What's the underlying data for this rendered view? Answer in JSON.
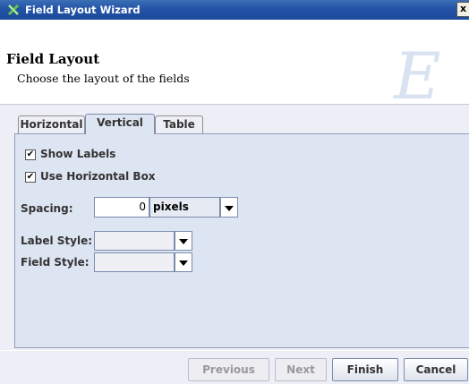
{
  "window": {
    "title": "Field Layout Wizard",
    "close_label": "x"
  },
  "header": {
    "title": "Field Layout",
    "subtitle": "Choose the layout of the fields",
    "logo_letter": "E"
  },
  "tabs": [
    {
      "label": "Horizontal",
      "active": false
    },
    {
      "label": "Vertical",
      "active": true
    },
    {
      "label": "Table",
      "active": false
    }
  ],
  "options": {
    "show_labels": {
      "label": "Show Labels",
      "checked": true
    },
    "use_horizontal_box": {
      "label": "Use Horizontal Box",
      "checked": true
    }
  },
  "spacing": {
    "label": "Spacing:",
    "value": "0",
    "unit": "pixels"
  },
  "label_style": {
    "label": "Label Style:",
    "value": ""
  },
  "field_style": {
    "label": "Field Style:",
    "value": ""
  },
  "buttons": {
    "previous": "Previous",
    "next": "Next",
    "finish": "Finish",
    "cancel": "Cancel"
  },
  "check_glyph": "✔"
}
